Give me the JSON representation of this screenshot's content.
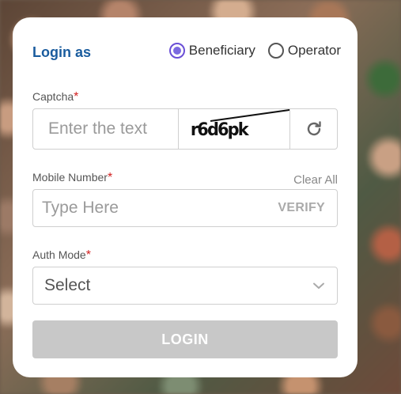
{
  "login_as": {
    "title": "Login as",
    "options": [
      {
        "label": "Beneficiary",
        "selected": true
      },
      {
        "label": "Operator",
        "selected": false
      }
    ]
  },
  "captcha": {
    "label": "Captcha",
    "required_mark": "*",
    "placeholder": "Enter the text",
    "image_text": "r6d6pk",
    "refresh_icon": "refresh-icon"
  },
  "mobile": {
    "label": "Mobile Number",
    "required_mark": "*",
    "clear_label": "Clear All",
    "placeholder": "Type Here",
    "verify_label": "VERIFY"
  },
  "auth_mode": {
    "label": "Auth Mode",
    "required_mark": "*",
    "selected": "Select",
    "chevron_icon": "chevron-down-icon"
  },
  "login_button": "LOGIN",
  "colors": {
    "accent": "#1a5c9e",
    "radio": "#7b6ae0",
    "required": "#d21f1f",
    "button_disabled": "#c8c8c8"
  }
}
